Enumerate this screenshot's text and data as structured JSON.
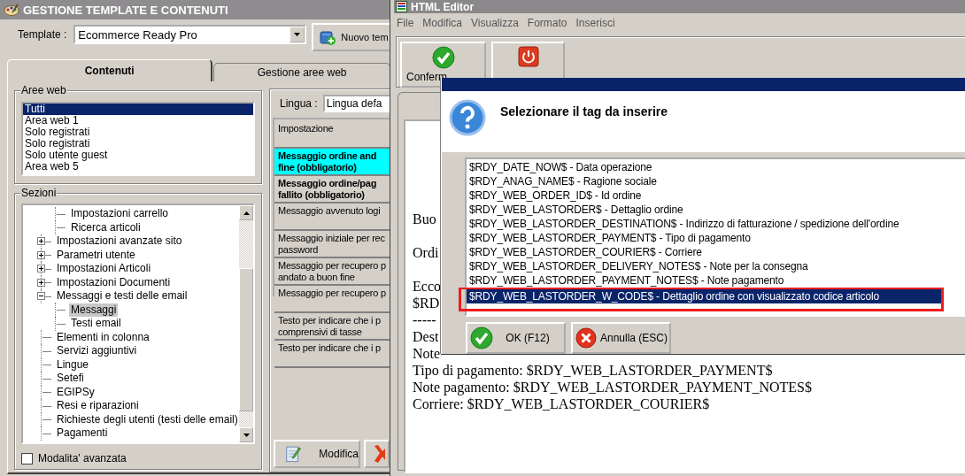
{
  "template_window": {
    "title": "GESTIONE TEMPLATE E CONTENUTI",
    "template_label": "Template :",
    "template_value": "Ecommerce Ready Pro",
    "new_button": "Nuovo tem",
    "tabs": [
      {
        "label": "Contenuti",
        "selected": true
      },
      {
        "label": "Gestione aree web",
        "selected": false
      }
    ],
    "web_areas": {
      "title": "Aree web",
      "items": [
        {
          "label": "Tutti",
          "selected": true
        },
        {
          "label": "Area web 1",
          "selected": false
        },
        {
          "label": "Solo registrati",
          "selected": false
        },
        {
          "label": "Solo registrati",
          "selected": false
        },
        {
          "label": "Solo utente guest",
          "selected": false
        },
        {
          "label": "Area web 5",
          "selected": false
        }
      ]
    },
    "sections": {
      "title": "Sezioni",
      "tree": [
        {
          "children": [
            {
              "label": "Impostazioni carrello",
              "selected": false
            },
            {
              "label": "Ricerca articoli",
              "selected": false
            }
          ]
        },
        {
          "label": "Impostazioni avanzate sito",
          "expanded": false,
          "selected": false
        },
        {
          "label": "Parametri utente",
          "expanded": false,
          "selected": false
        },
        {
          "label": "Impostazioni Articoli",
          "expanded": false,
          "selected": false
        },
        {
          "label": "Impostazioni Documenti",
          "expanded": false,
          "selected": false
        },
        {
          "label": "Messaggi e testi delle email",
          "expanded": true,
          "selected": false,
          "children": [
            {
              "label": "Messaggi",
              "selected": true
            },
            {
              "label": "Testi email",
              "selected": false
            }
          ]
        },
        {
          "label": "Elementi in colonna",
          "selected": false
        },
        {
          "label": "Servizi aggiuntivi",
          "selected": false
        },
        {
          "label": "Lingue",
          "selected": false
        },
        {
          "label": "Setefi",
          "selected": false
        },
        {
          "label": "EGIPSy",
          "selected": false
        },
        {
          "label": "Resi e riparazioni",
          "selected": false
        },
        {
          "label": "Richieste degli utenti (testi delle email)",
          "selected": false
        },
        {
          "label": "Pagamenti",
          "selected": false
        }
      ]
    },
    "advanced_mode": {
      "label": "Modalita' avanzata",
      "checked": false
    },
    "language_label": "Lingua :",
    "language_value": "Lingua defa",
    "settings": {
      "header": "Impostazione",
      "rows": [
        {
          "lines": [
            "Messaggio ordine and",
            "fine (obbligatorio)"
          ],
          "selected": true,
          "required": true
        },
        {
          "lines": [
            "Messaggio ordine/pag",
            "fallito (obbligatorio)"
          ],
          "selected": false,
          "required": true
        },
        {
          "lines": [
            "Messaggio avvenuto logi"
          ],
          "selected": false,
          "required": false
        },
        {
          "lines": [
            "Messaggio iniziale per rec",
            "password"
          ],
          "selected": false,
          "required": false
        },
        {
          "lines": [
            "Messaggio per recupero p",
            "andato a buon fine"
          ],
          "selected": false,
          "required": false
        },
        {
          "lines": [
            "Messaggio per recupero p"
          ],
          "selected": false,
          "required": false
        },
        {
          "lines": [
            "Testo per indicare che i p",
            "comprensivi di tasse"
          ],
          "selected": false,
          "required": false
        },
        {
          "lines": [
            "Testo per indicare che i p"
          ],
          "selected": false,
          "required": false
        }
      ]
    },
    "buttons": [
      {
        "label": "Modifica",
        "kind": "edit"
      },
      {
        "kind": "delete"
      }
    ]
  },
  "html_editor": {
    "title": "HTML Editor",
    "menu": [
      "File",
      "Modifica",
      "Visualizza",
      "Formato",
      "Inserisci"
    ],
    "toolbar": [
      {
        "label": "Conferm",
        "kind": "confirm"
      },
      {
        "kind": "cancel"
      }
    ],
    "document": {
      "paragraphs": [
        [
          "Buo"
        ],
        [
          "Ordi"
        ],
        [
          "Ecco",
          "$RD",
          "-----",
          "Dest",
          "Note",
          "Tipo di pagamento: $RDY_WEB_LASTORDER_PAYMENT$",
          "Note pagamento: $RDY_WEB_LASTORDER_PAYMENT_NOTES$",
          "Corriere: $RDY_WEB_LASTORDER_COURIER$"
        ]
      ]
    }
  },
  "tag_dialog": {
    "prompt": "Selezionare il tag da inserire",
    "tags": [
      {
        "label": "$RDY_DATE_NOW$ - Data operazione",
        "selected": false,
        "annotated": false
      },
      {
        "label": "$RDY_ANAG_NAME$ - Ragione sociale",
        "selected": false,
        "annotated": false
      },
      {
        "label": "$RDY_WEB_ORDER_ID$ - Id ordine",
        "selected": false,
        "annotated": false
      },
      {
        "label": "$RDY_WEB_LASTORDER$ - Dettaglio ordine",
        "selected": false,
        "annotated": false
      },
      {
        "label": "$RDY_WEB_LASTORDER_DESTINATION$ - Indirizzo di fatturazione / spedizione dell'ordine",
        "selected": false,
        "annotated": false
      },
      {
        "label": "$RDY_WEB_LASTORDER_PAYMENT$ - Tipo di pagamento",
        "selected": false,
        "annotated": false
      },
      {
        "label": "$RDY_WEB_LASTORDER_COURIER$ - Corriere",
        "selected": false,
        "annotated": false
      },
      {
        "label": "$RDY_WEB_LASTORDER_DELIVERY_NOTES$ - Note per la consegna",
        "selected": false,
        "annotated": false
      },
      {
        "label": "$RDY_WEB_LASTORDER_PAYMENT_NOTES$ - Note pagamento",
        "selected": false,
        "annotated": false
      },
      {
        "label": "$RDY_WEB_LASTORDER_W_CODE$ - Dettaglio ordine con visualizzato codice articolo",
        "selected": true,
        "annotated": true
      }
    ],
    "buttons": [
      {
        "label": "OK (F12)",
        "kind": "ok"
      },
      {
        "label": "Annulla (ESC)",
        "kind": "cancel"
      }
    ]
  }
}
